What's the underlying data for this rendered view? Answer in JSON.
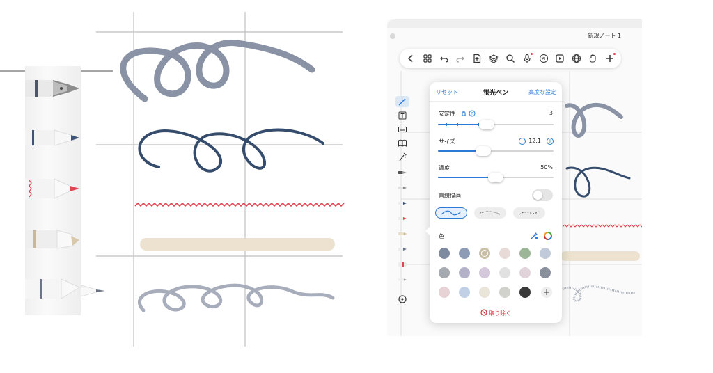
{
  "app": {
    "note_title": "新規ノート 1"
  },
  "toolbar": {
    "buttons": [
      "back-icon",
      "grid-icon",
      "undo-icon",
      "redo-icon",
      "add-page-icon",
      "layers-icon",
      "search-icon",
      "mic-icon",
      "ai-icon",
      "play-icon",
      "globe-icon",
      "hand-icon",
      "add-icon"
    ]
  },
  "popover": {
    "reset_label": "リセット",
    "title": "蛍光ペン",
    "advanced_label": "高度な設定",
    "stability": {
      "label": "安定性",
      "value": "3",
      "level": 0.42
    },
    "size": {
      "label": "サイズ",
      "value": "12.1",
      "level": 0.39
    },
    "opacity": {
      "label": "濃度",
      "value": "50%",
      "level": 0.5
    },
    "straight_line": {
      "label": "直線描画",
      "on": false
    },
    "color_label": "色",
    "remove_label": "取り除く",
    "colors": [
      "#7d8aa0",
      "#8e9bb5",
      "#c8bfa6",
      "#e8dad7",
      "#9cb596",
      "#c0cad8",
      "#a5a9b0",
      "#b4b2c9",
      "#d6c8db",
      "#e1e1e1",
      "#e0d3da",
      "#8a8f9c",
      "#e7d2d6",
      "#c2d0e5",
      "#e9e5d8",
      "#d2d2cd",
      "#3a3a3a"
    ],
    "selected_color_index": 2
  },
  "colors": {
    "accent": "#2a7ad6",
    "danger": "#d6323c",
    "stroke_gray": "#8a92a6",
    "stroke_navy": "#354c6d",
    "stroke_red": "#e04452",
    "stroke_beige": "#ece2cf"
  }
}
